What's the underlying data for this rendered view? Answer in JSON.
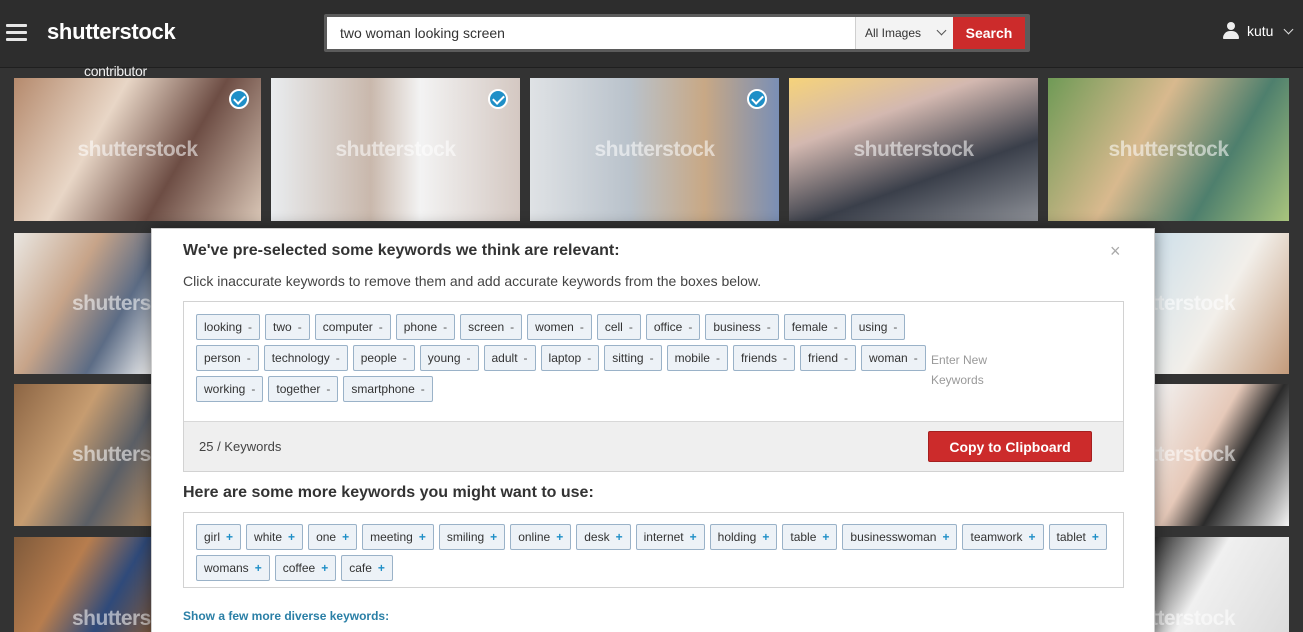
{
  "header": {
    "logo_brand": "shutterstock",
    "logo_sub": "contributor",
    "search_value": "two woman looking screen",
    "search_scope": "All Images",
    "search_button": "Search",
    "username": "kutu"
  },
  "grid": {
    "watermark": "shutterstock"
  },
  "modal": {
    "title": "We've pre-selected some keywords we think are relevant:",
    "subtitle": "Click inaccurate keywords to remove them and add accurate keywords from the boxes below.",
    "close_symbol": "×",
    "selected_keywords": [
      "looking",
      "two",
      "computer",
      "phone",
      "screen",
      "women",
      "cell",
      "office",
      "business",
      "female",
      "using",
      "person",
      "technology",
      "people",
      "young",
      "adult",
      "laptop",
      "sitting",
      "mobile",
      "friends",
      "friend",
      "woman",
      "working",
      "together",
      "smartphone"
    ],
    "remove_symbol": "-",
    "add_symbol": "+",
    "keyword_input_placeholder": "Enter New Keywords",
    "count_text": "25 / Keywords",
    "copy_button": "Copy to Clipboard",
    "more_title": "Here are some more keywords you might want to use:",
    "more_keywords": [
      "girl",
      "white",
      "one",
      "meeting",
      "smiling",
      "online",
      "desk",
      "internet",
      "holding",
      "table",
      "businesswoman",
      "teamwork",
      "tablet",
      "womans",
      "coffee",
      "cafe"
    ],
    "diverse_link": "Show a few more diverse keywords:"
  }
}
